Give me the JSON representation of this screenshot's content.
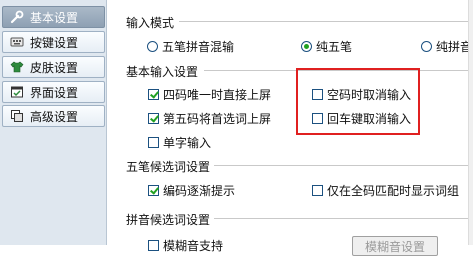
{
  "sidebar": {
    "items": [
      {
        "label": "基本设置",
        "icon": "wrench-icon",
        "active": true
      },
      {
        "label": "按键设置",
        "icon": "keyboard-icon",
        "active": false
      },
      {
        "label": "皮肤设置",
        "icon": "tshirt-icon",
        "active": false
      },
      {
        "label": "界面设置",
        "icon": "window-icon",
        "active": false
      },
      {
        "label": "高级设置",
        "icon": "copy-icon",
        "active": false
      }
    ]
  },
  "input_mode": {
    "title": "输入模式",
    "options": [
      {
        "label": "五笔拼音混输",
        "checked": false
      },
      {
        "label": "纯五笔",
        "checked": true
      },
      {
        "label": "纯拼音",
        "checked": false
      }
    ]
  },
  "basic_input": {
    "title": "基本输入设置",
    "options": [
      {
        "label": "四码唯一时直接上屏",
        "checked": true
      },
      {
        "label": "第五码将首选词上屏",
        "checked": true
      },
      {
        "label": "单字输入",
        "checked": false
      },
      {
        "label": "空码时取消输入",
        "checked": false
      },
      {
        "label": "回车键取消输入",
        "checked": false
      }
    ]
  },
  "wubi_candidates": {
    "title": "五笔候选词设置",
    "options": [
      {
        "label": "编码逐渐提示",
        "checked": true
      },
      {
        "label": "仅在全码匹配时显示词组",
        "checked": false
      }
    ]
  },
  "pinyin_candidates": {
    "title": "拼音候选词设置",
    "fuzzy_option": {
      "label": "模糊音支持",
      "checked": false
    },
    "fuzzy_button": "模糊音设置"
  },
  "colors": {
    "sidebar_bg": "#dfe7ef",
    "active_item": "#8ea0b3",
    "check_green": "#21a121",
    "highlight_red": "#e02020"
  }
}
